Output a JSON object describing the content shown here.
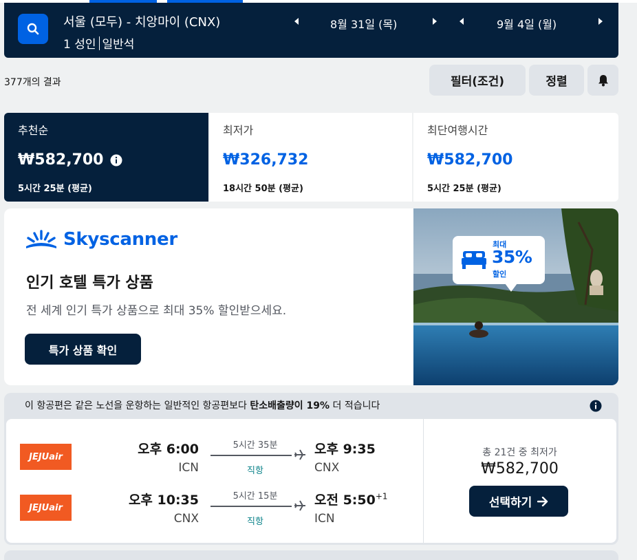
{
  "search": {
    "route": "서울 (모두) - 치앙마이 (CNX)",
    "passengers": "1 성인",
    "cabin": "일반석",
    "depart_date": "8월 31일 (목)",
    "return_date": "9월 4일 (월)"
  },
  "results": {
    "count_text": "377개의 결과",
    "filter_label": "필터(조건)",
    "sort_label": "정렬"
  },
  "tabs": [
    {
      "label": "추천순",
      "price": "₩582,700",
      "duration": "5시간 25분 (평균)"
    },
    {
      "label": "최저가",
      "price": "₩326,732",
      "duration": "18시간 50분 (평균)"
    },
    {
      "label": "최단여행시간",
      "price": "₩582,700",
      "duration": "5시간 25분 (평균)"
    }
  ],
  "promo": {
    "brand": "Skyscanner",
    "title": "인기 호텔 특가 상품",
    "description": "전 세계 인기 특가 상품으로 최대 35% 할인받으세요.",
    "cta": "특가 상품 확인",
    "badge_top": "최대",
    "badge_value": "35%",
    "badge_bottom": "할인"
  },
  "flight": {
    "eco_prefix": "이 항공편은 같은 노선을 운항하는 일반적인 항공편보다 ",
    "eco_bold": "탄소배출량이 19%",
    "eco_suffix": " 더 적습니다",
    "airline_logo_text": "JEJUair",
    "outbound": {
      "depart_time": "오후 6:00",
      "depart_code": "ICN",
      "duration": "5시간 35분",
      "stops": "직항",
      "arrive_time": "오후 9:35",
      "arrive_code": "CNX"
    },
    "inbound": {
      "depart_time": "오후 10:35",
      "depart_code": "CNX",
      "duration": "5시간 15분",
      "stops": "직항",
      "arrive_time": "오전 5:50",
      "arrive_offset": "+1",
      "arrive_code": "ICN"
    },
    "deal_label": "총 21건 중 최저가",
    "deal_price": "₩582,700",
    "select_label": "선택하기"
  },
  "colors": {
    "navy": "#05203c",
    "blue": "#0062e3",
    "jeju": "#f15a22",
    "teal": "#0c838a"
  }
}
